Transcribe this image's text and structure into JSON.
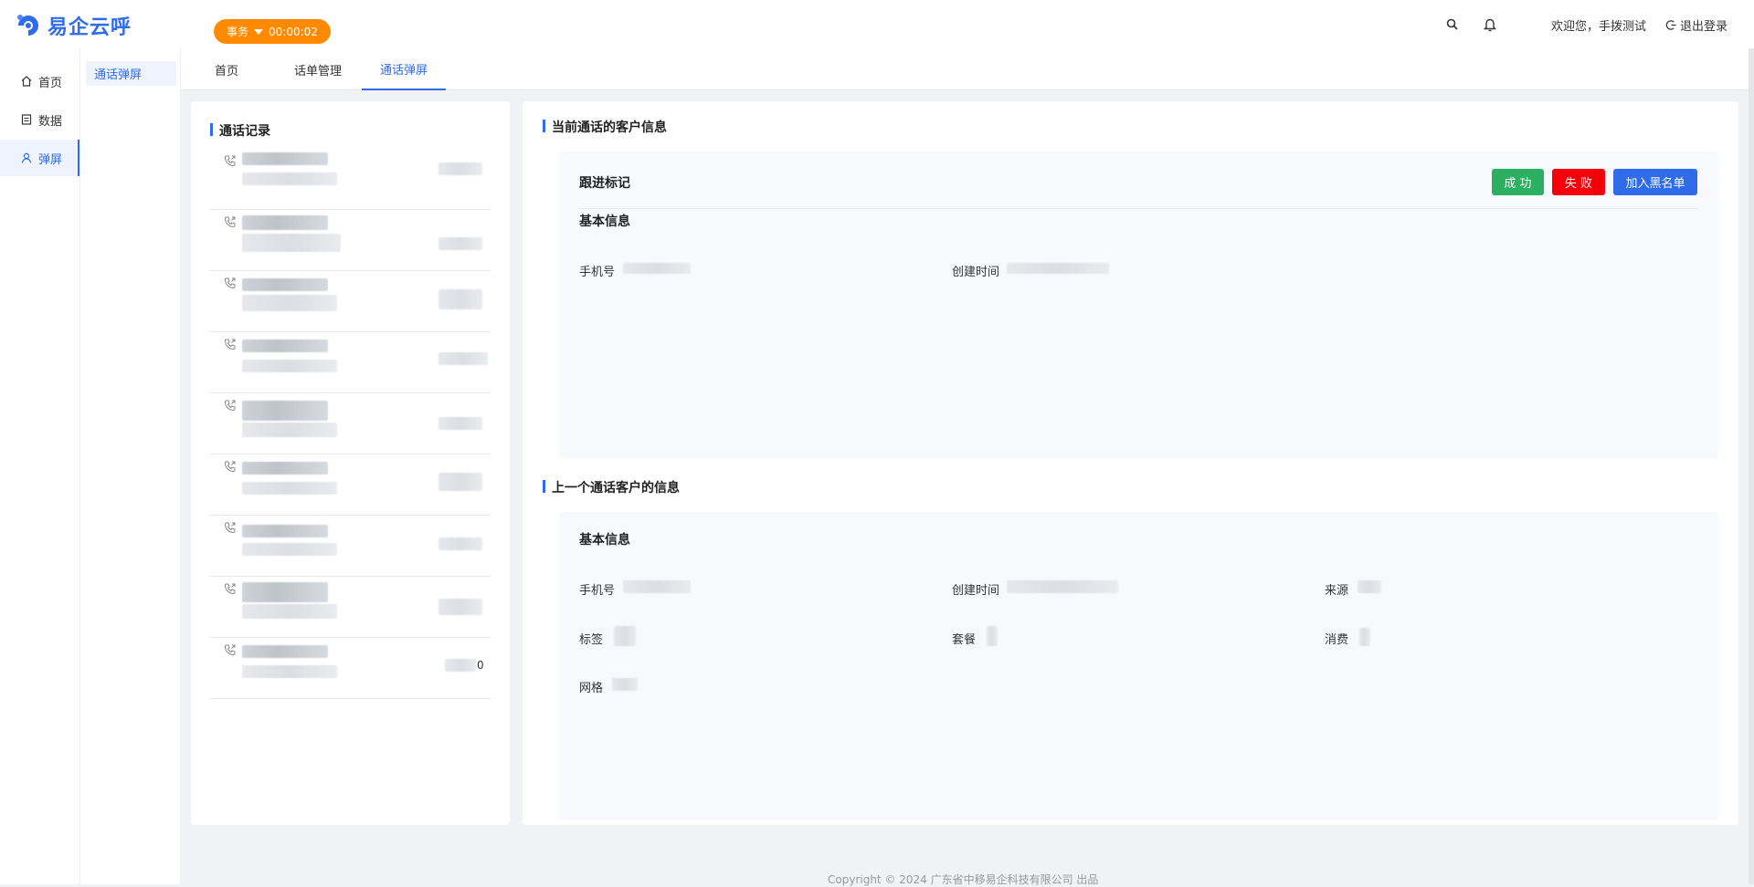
{
  "header": {
    "app_name": "易企云呼",
    "status": {
      "label": "事务",
      "timer": "00:00:02"
    },
    "welcome": "欢迎您，手拨测试",
    "logout": "退出登录",
    "icons": [
      "search-icon",
      "bell-icon"
    ]
  },
  "sidebar": {
    "items": [
      {
        "label": "首页",
        "icon": "home-icon"
      },
      {
        "label": "数据",
        "icon": "document-icon"
      },
      {
        "label": "弹屏",
        "icon": "user-icon"
      }
    ]
  },
  "subnav": {
    "item": "通话弹屏"
  },
  "tabs": [
    {
      "label": "首页"
    },
    {
      "label": "话单管理"
    },
    {
      "label": "通话弹屏"
    }
  ],
  "call_records": {
    "title": "通话记录",
    "last_row_suffix": "0"
  },
  "current_customer": {
    "title": "当前通话的客户信息",
    "follow_up": "跟进标记",
    "buttons": {
      "success": "成 功",
      "fail": "失 败",
      "blacklist": "加入黑名单"
    },
    "basic_info": "基本信息",
    "fields": {
      "phone": "手机号",
      "created": "创建时间"
    }
  },
  "previous_customer": {
    "title": "上一个通话客户的信息",
    "basic_info": "基本信息",
    "fields": {
      "phone": "手机号",
      "created": "创建时间",
      "source": "来源",
      "tag": "标签",
      "package": "套餐",
      "spend": "消费",
      "grid": "网格"
    }
  },
  "footer": "Copyright © 2024 广东省中移易企科技有限公司 出品",
  "colors": {
    "accent": "#2f6bea",
    "status_orange": "#ff8a00",
    "success": "#2bb061",
    "danger": "#f5000a"
  }
}
